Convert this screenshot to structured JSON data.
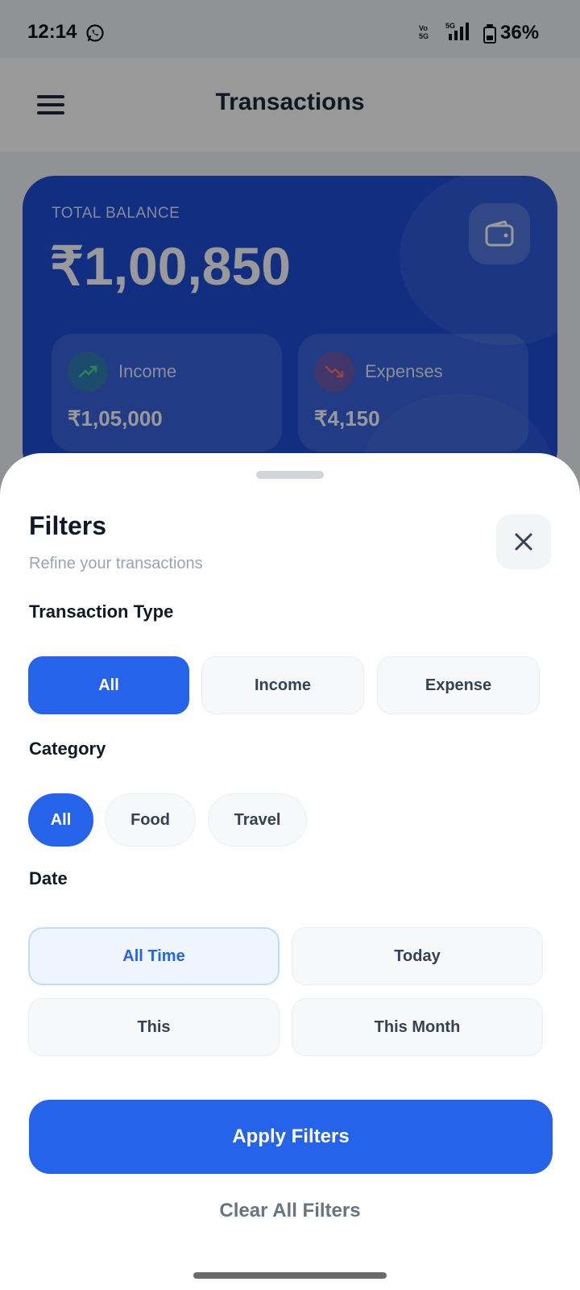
{
  "status_bar": {
    "time": "12:14",
    "volte_line1": "Vo",
    "volte_line2": "5G",
    "network": "5G",
    "battery_percent_text": "36%",
    "battery_level": 0.36
  },
  "app_bar": {
    "title": "Transactions",
    "menu_icon": "hamburger-menu-icon"
  },
  "balance_card": {
    "label": "TOTAL BALANCE",
    "amount": "₹1,00,850",
    "wallet_icon": "wallet-icon",
    "income": {
      "label": "Income",
      "amount": "₹1,05,000",
      "icon": "trending-up-icon"
    },
    "expenses": {
      "label": "Expenses",
      "amount": "₹4,150",
      "icon": "trending-down-icon"
    },
    "colors": {
      "card": "#1d4ed8"
    }
  },
  "filters_sheet": {
    "title": "Filters",
    "subtitle": "Refine your transactions",
    "close_icon": "close-icon",
    "transaction_type": {
      "label": "Transaction Type",
      "options": [
        "All",
        "Income",
        "Expense"
      ],
      "selected": "All"
    },
    "category": {
      "label": "Category",
      "options": [
        "All",
        "Food",
        "Travel"
      ],
      "selected": "All"
    },
    "date": {
      "label": "Date",
      "options": [
        "All Time",
        "Today",
        "This",
        "This Month"
      ],
      "selected": "All Time"
    },
    "apply_label": "Apply Filters",
    "clear_label": "Clear All Filters",
    "colors": {
      "accent": "#2563eb",
      "muted": "#6b7280"
    }
  }
}
